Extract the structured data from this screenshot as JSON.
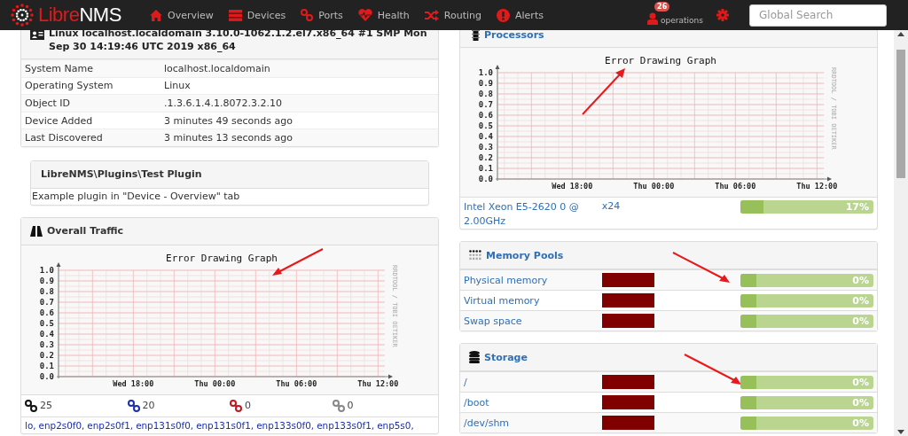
{
  "navbar": {
    "logo": {
      "part1": "Libre",
      "part2": "NMS"
    },
    "items": [
      {
        "label": "Overview"
      },
      {
        "label": "Devices"
      },
      {
        "label": "Ports"
      },
      {
        "label": "Health"
      },
      {
        "label": "Routing"
      },
      {
        "label": "Alerts"
      }
    ],
    "user": {
      "badge": "26",
      "name": "operations"
    },
    "search": {
      "placeholder": "Global Search"
    }
  },
  "device": {
    "title": "Linux localhost.localdomain 3.10.0-1062.1.2.el7.x86_64 #1 SMP Mon Sep 30 14:19:46 UTC 2019 x86_64",
    "rows": [
      {
        "label": "System Name",
        "value": "localhost.localdomain"
      },
      {
        "label": "Operating System",
        "value": "Linux"
      },
      {
        "label": "Object ID",
        "value": ".1.3.6.1.4.1.8072.3.2.10"
      },
      {
        "label": "Device Added",
        "value": "3 minutes 49 seconds ago"
      },
      {
        "label": "Last Discovered",
        "value": "3 minutes 13 seconds ago"
      }
    ]
  },
  "plugin": {
    "title": "LibreNMS\\Plugins\\Test Plugin",
    "body": "Example plugin in \"Device - Overview\" tab"
  },
  "traffic": {
    "title": "Overall Traffic",
    "graph": {
      "side_label": "RRDTOOL / TOBI OETIKER",
      "chart_data": {
        "type": "line",
        "title": "Error Drawing Graph",
        "categories": [
          null,
          null,
          null,
          null,
          null,
          "Wed 18:00",
          null,
          null,
          null,
          null,
          null,
          "Thu 00:00",
          null,
          null,
          null,
          null,
          null,
          "Thu 06:00",
          null,
          null,
          null,
          null,
          null,
          "Thu 12:00"
        ],
        "ylim": [
          0,
          1
        ],
        "grid": true,
        "yticks": [
          {
            "value": 0,
            "label": "0.0"
          },
          {
            "value": 0.1,
            "label": "0.1"
          },
          {
            "value": 0.2,
            "label": "0.2"
          },
          {
            "value": 0.3,
            "label": "0.3"
          },
          {
            "value": 0.4,
            "label": "0.4"
          },
          {
            "value": 0.5,
            "label": "0.5"
          },
          {
            "value": 0.6,
            "label": "0.6"
          },
          {
            "value": 0.7,
            "label": "0.7"
          },
          {
            "value": 0.8,
            "label": "0.8"
          },
          {
            "value": 0.9,
            "label": "0.9"
          },
          {
            "value": 1,
            "label": "1.0"
          }
        ]
      }
    },
    "counts": [
      {
        "count": "25",
        "color": "#111111"
      },
      {
        "count": "20",
        "color": "#1a2fa8"
      },
      {
        "count": "0",
        "color": "#c0161b"
      },
      {
        "count": "0",
        "color": "#888888"
      }
    ],
    "interfaces": [
      "lo,",
      "enp2s0f0,",
      "enp2s0f1,",
      "enp131s0f0,",
      "enp131s0f1,",
      "enp133s0f0,",
      "enp133s0f1,",
      "enp5s0,"
    ]
  },
  "processors": {
    "title": "Processors",
    "graph": {
      "side_label": "RRDTOOL / TOBI OETIKER",
      "chart_data": {
        "type": "line",
        "title": "Error Drawing Graph",
        "categories": [
          null,
          null,
          null,
          null,
          null,
          "Wed 18:00",
          null,
          null,
          null,
          null,
          null,
          "Thu 00:00",
          null,
          null,
          null,
          null,
          null,
          "Thu 06:00",
          null,
          null,
          null,
          null,
          null,
          "Thu 12:00"
        ],
        "ylim": [
          0,
          1
        ],
        "grid": true,
        "yticks": [
          {
            "value": 0,
            "label": "0.0"
          },
          {
            "value": 0.1,
            "label": "0.1"
          },
          {
            "value": 0.2,
            "label": "0.2"
          },
          {
            "value": 0.3,
            "label": "0.3"
          },
          {
            "value": 0.4,
            "label": "0.4"
          },
          {
            "value": 0.5,
            "label": "0.5"
          },
          {
            "value": 0.6,
            "label": "0.6"
          },
          {
            "value": 0.7,
            "label": "0.7"
          },
          {
            "value": 0.8,
            "label": "0.8"
          },
          {
            "value": 0.9,
            "label": "0.9"
          },
          {
            "value": 1,
            "label": "1.0"
          }
        ]
      }
    },
    "rows": [
      {
        "name": "Intel Xeon E5-2620 0 @ 2.00GHz",
        "count": "x24",
        "level": 0.17,
        "reading": "17%"
      }
    ]
  },
  "memory_pools": {
    "title": "Memory Pools",
    "rows": [
      {
        "name": "Physical memory",
        "level": 0,
        "reading": "0%"
      },
      {
        "name": "Virtual memory",
        "level": 0,
        "reading": "0%"
      },
      {
        "name": "Swap space",
        "level": 0,
        "reading": "0%"
      }
    ]
  },
  "storage": {
    "title": "Storage",
    "rows": [
      {
        "name": "/",
        "level": 0,
        "reading": "0%"
      },
      {
        "name": "/boot",
        "level": 0,
        "reading": "0%"
      },
      {
        "name": "/dev/shm",
        "level": 0,
        "reading": "0%"
      }
    ]
  }
}
